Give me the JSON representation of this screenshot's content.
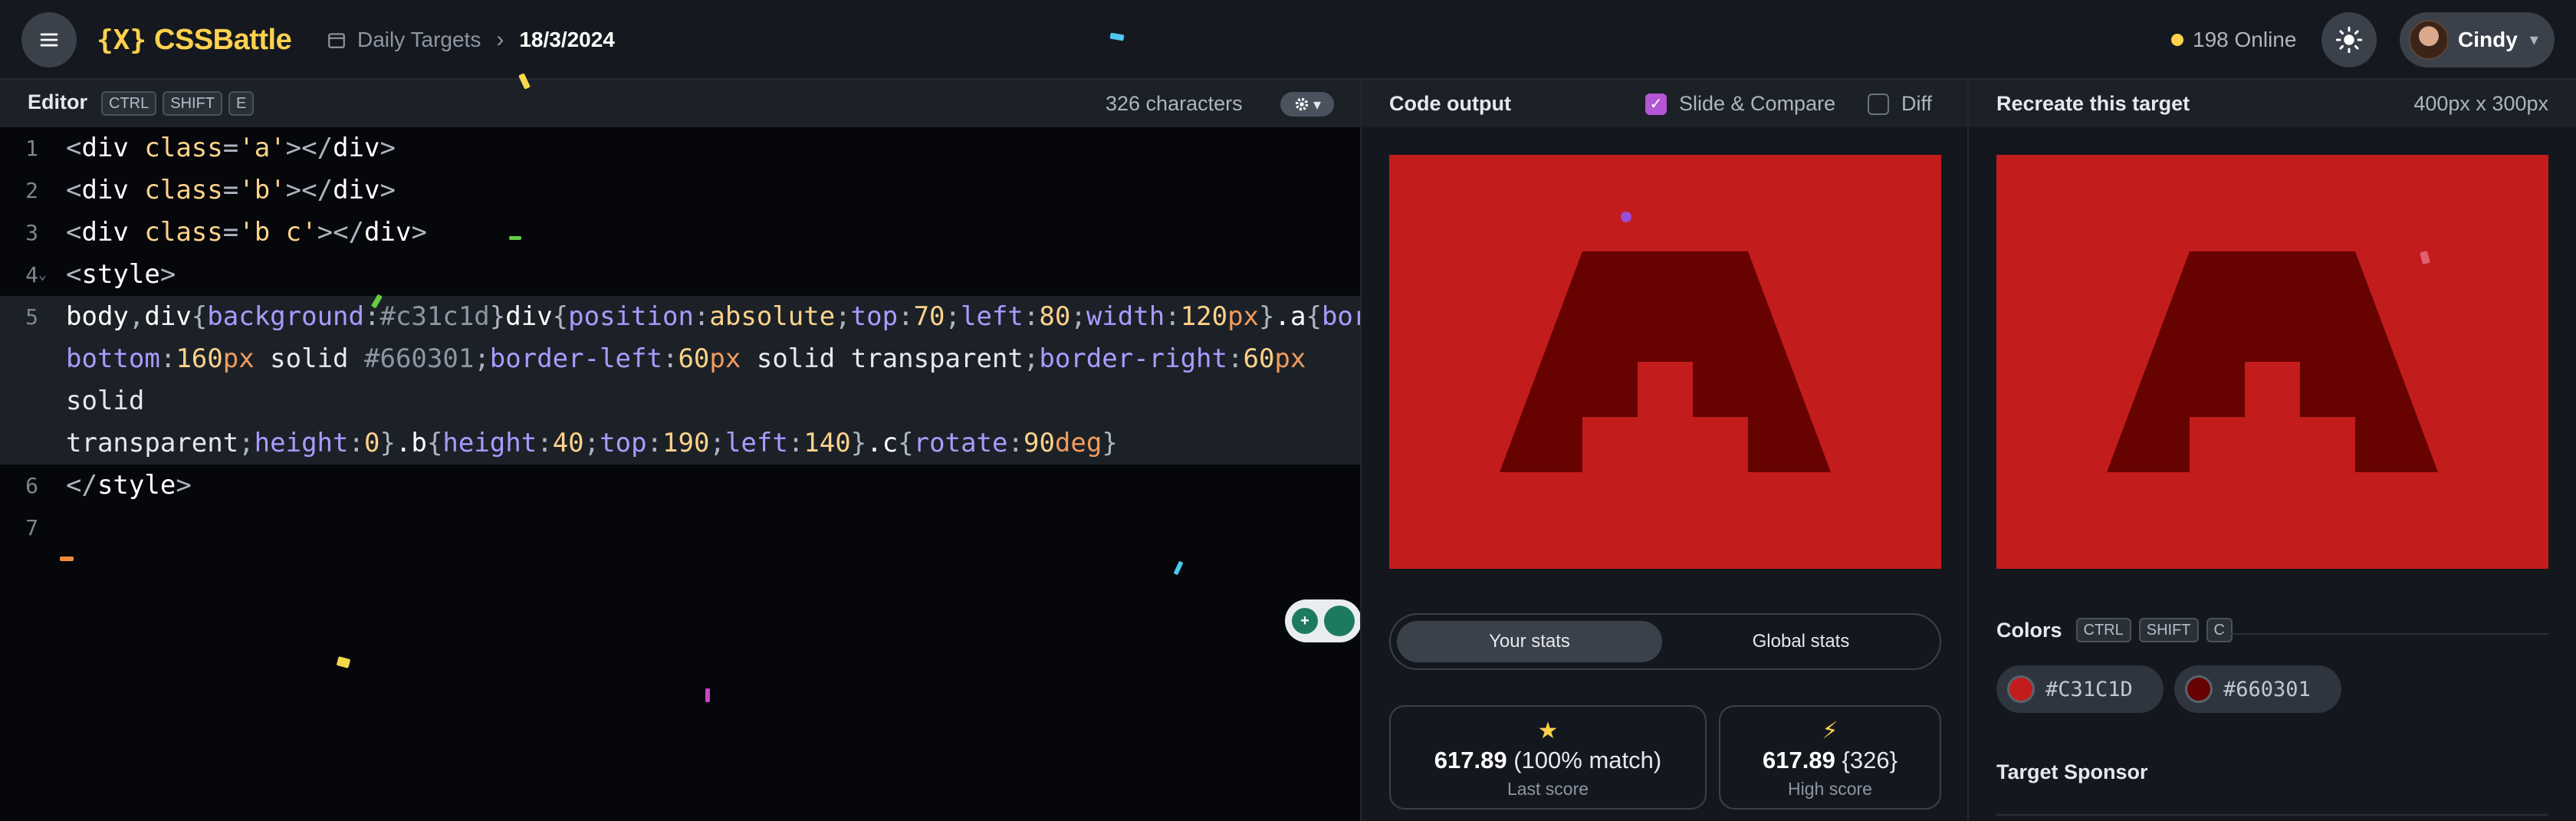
{
  "topbar": {
    "logo_mark": "{X}",
    "logo_text": "CSSBattle",
    "breadcrumb_section": "Daily Targets",
    "breadcrumb_date": "18/3/2024",
    "online_text": "198 Online",
    "user_name": "Cindy"
  },
  "editor": {
    "title": "Editor",
    "shortcut_keys": [
      "CTRL",
      "SHIFT",
      "E"
    ],
    "char_count": "326 characters",
    "line_numbers": [
      "1",
      "2",
      "3",
      "4",
      "5",
      "6",
      "7"
    ]
  },
  "output": {
    "title": "Code output",
    "slide_compare_label": "Slide & Compare",
    "slide_compare_checked": true,
    "diff_label": "Diff",
    "diff_checked": false,
    "tab_your_stats": "Your stats",
    "tab_global_stats": "Global stats",
    "last_score_value": "617.89",
    "last_score_match": "(100% match)",
    "last_score_label": "Last score",
    "high_score_value": "617.89",
    "high_score_chars": "{326}",
    "high_score_label": "High score"
  },
  "target": {
    "title": "Recreate this target",
    "dimensions": "400px x 300px",
    "colors_title": "Colors",
    "colors_keys": [
      "CTRL",
      "SHIFT",
      "C"
    ],
    "colors": [
      {
        "hex": "#C31C1D",
        "value": "#c31c1d"
      },
      {
        "hex": "#660301",
        "value": "#660301"
      }
    ],
    "sponsor_title": "Target Sponsor"
  },
  "theme": {
    "accent": "#ffd24d",
    "checkbox": "#b455d6",
    "canvas_bg": "#c31c1d",
    "shape_color": "#660301"
  }
}
